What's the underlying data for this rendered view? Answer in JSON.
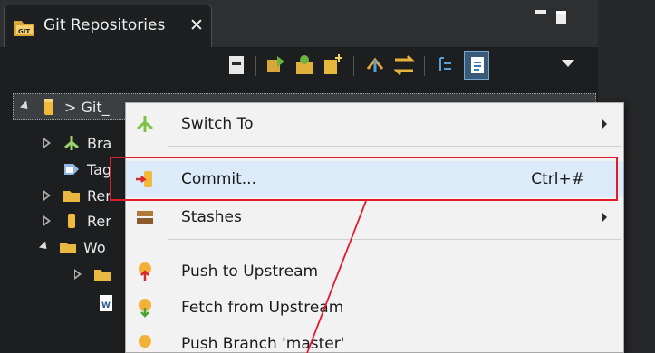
{
  "view_tab": {
    "title": "Git Repositories",
    "close_symbol": "✕",
    "icon": "git-repositories-icon"
  },
  "window_controls": {
    "minimize_icon": "minimize-icon",
    "maximize_icon": "maximize-icon"
  },
  "toolbar": {
    "buttons": [
      "collapse-all-icon",
      "clone-repository-icon",
      "add-repository-icon",
      "create-repository-icon",
      "fetch-icon",
      "pull-icon",
      "tree-layout-icon",
      "link-with-selection-icon"
    ],
    "menu_icon": "view-menu-icon"
  },
  "tree": {
    "rows": [
      {
        "label": "> Git_",
        "icon": "repository-icon"
      },
      {
        "label": "Bra",
        "icon": "branches-icon"
      },
      {
        "label": "Tag",
        "icon": "tags-icon"
      },
      {
        "label": "Rer",
        "icon": "folder-icon"
      },
      {
        "label": "Rer",
        "icon": "remotes-icon"
      },
      {
        "label": "Wo",
        "icon": "working-tree-icon"
      },
      {
        "label": "",
        "icon": "folder-icon"
      },
      {
        "label": "",
        "icon": "word-file-icon"
      }
    ]
  },
  "context_menu": {
    "items": [
      {
        "label": "Switch To",
        "icon": "switch-to-icon",
        "submenu": true
      },
      {
        "label": "Commit...",
        "accel": "Ctrl+#",
        "icon": "commit-icon"
      },
      {
        "label": "Stashes",
        "icon": "stashes-icon",
        "submenu": true
      },
      {
        "label": "Push to Upstream",
        "icon": "push-icon"
      },
      {
        "label": "Fetch from Upstream",
        "icon": "fetch-upstream-icon"
      },
      {
        "label": "Push Branch 'master'",
        "icon": "push-branch-icon"
      }
    ]
  },
  "annotation": {
    "color": "#e21b2b"
  },
  "colors": {
    "view_bg": "#1d1e1f",
    "menu_bg": "#f2f2f2",
    "hover_bg": "#dcebfa",
    "accent_red": "#e21b2b"
  }
}
